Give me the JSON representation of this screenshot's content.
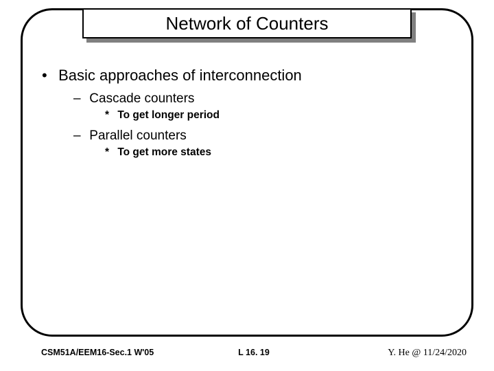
{
  "slide": {
    "title": "Network of Counters",
    "bullets": {
      "main": "Basic approaches of interconnection",
      "sub1": "Cascade counters",
      "sub1_detail": "To get longer period",
      "sub2": "Parallel counters",
      "sub2_detail": "To get more states"
    }
  },
  "footer": {
    "left": "CSM51A/EEM16-Sec.1 W'05",
    "center": "L 16. 19",
    "right": "Y. He @ 11/24/2020"
  }
}
